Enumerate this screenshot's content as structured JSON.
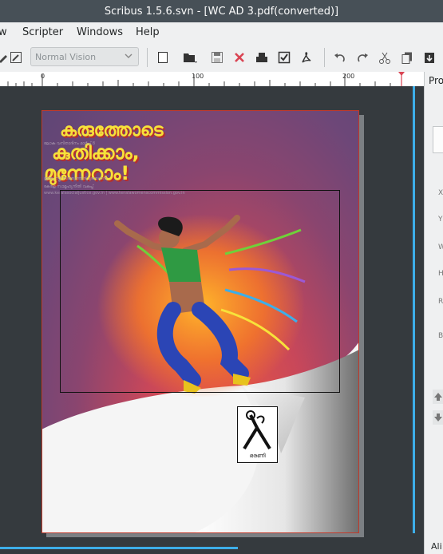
{
  "window": {
    "title": "Scribus 1.5.6.svn - [WC AD 3.pdf(converted)]"
  },
  "menu": [
    "w",
    "Scripter",
    "Windows",
    "Help"
  ],
  "toolbar": {
    "preview_mode": "Normal Vision",
    "buttons": [
      "new-document-icon",
      "open-icon",
      "save-icon",
      "close-icon",
      "print-icon",
      "preflight-icon",
      "export-pdf-icon",
      "undo-icon",
      "redo-icon",
      "cut-icon",
      "copy-icon",
      "paste-icon"
    ]
  },
  "ruler": {
    "labels": [
      "0",
      "100",
      "200"
    ]
  },
  "page": {
    "headline": [
      "കരുത്തോടെ",
      "കുതിക്കാം,",
      "മുന്നേറാം!"
    ],
    "fine_print": [
      "ലോക വനിതാദിനം മാർച്ച് 8",
      "ഇന്ത്യ സ്ത്രീ സമത്വത്തിൽ മുന്നേറാൻ",
      "കേരള സാമൂഹ്യനീതി വകുപ്പ്",
      "www.keralasocialjustice.gov.in | www.keralawomenscommission.gov.in"
    ],
    "logo_caption": "ഭരണി"
  },
  "properties_panel": {
    "title": "Pro",
    "labels": [
      "X",
      "Y",
      "W",
      "H",
      "R",
      "B"
    ],
    "bottom_label": "Ali"
  },
  "colors": {
    "accent": "#3daee9",
    "workspace": "#353a3e",
    "page_border": "#c0392b",
    "headline": "#f7e23a"
  }
}
